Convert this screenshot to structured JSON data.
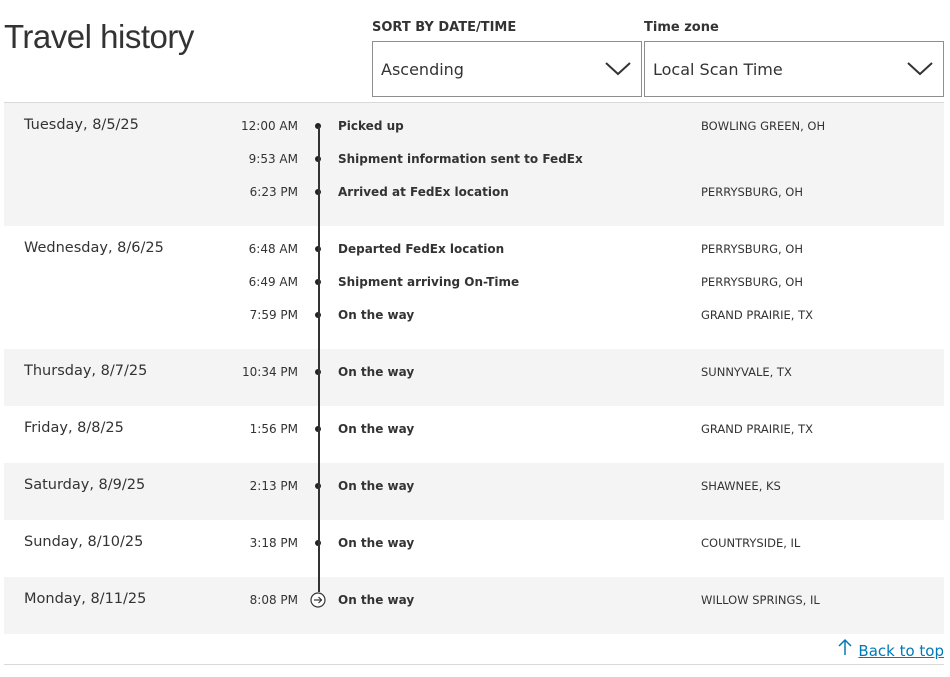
{
  "title": "Travel history",
  "sort": {
    "label": "SORT BY DATE/TIME",
    "value": "Ascending"
  },
  "timezone": {
    "label": "Time zone",
    "value": "Local Scan Time"
  },
  "groups": [
    {
      "day": "Tuesday, 8/5/25",
      "events": [
        {
          "time": "12:00 AM",
          "status": "Picked up",
          "location": "BOWLING GREEN, OH"
        },
        {
          "time": "9:53 AM",
          "status": "Shipment information sent to FedEx",
          "location": ""
        },
        {
          "time": "6:23 PM",
          "status": "Arrived at FedEx location",
          "location": "PERRYSBURG, OH"
        }
      ]
    },
    {
      "day": "Wednesday, 8/6/25",
      "events": [
        {
          "time": "6:48 AM",
          "status": "Departed FedEx location",
          "location": "PERRYSBURG, OH"
        },
        {
          "time": "6:49 AM",
          "status": "Shipment arriving On-Time",
          "location": "PERRYSBURG, OH"
        },
        {
          "time": "7:59 PM",
          "status": "On the way",
          "location": "GRAND PRAIRIE, TX"
        }
      ]
    },
    {
      "day": "Thursday, 8/7/25",
      "events": [
        {
          "time": "10:34 PM",
          "status": "On the way",
          "location": "SUNNYVALE, TX"
        }
      ]
    },
    {
      "day": "Friday, 8/8/25",
      "events": [
        {
          "time": "1:56 PM",
          "status": "On the way",
          "location": "GRAND PRAIRIE, TX"
        }
      ]
    },
    {
      "day": "Saturday, 8/9/25",
      "events": [
        {
          "time": "2:13 PM",
          "status": "On the way",
          "location": "SHAWNEE, KS"
        }
      ]
    },
    {
      "day": "Sunday, 8/10/25",
      "events": [
        {
          "time": "3:18 PM",
          "status": "On the way",
          "location": "COUNTRYSIDE, IL"
        }
      ]
    },
    {
      "day": "Monday, 8/11/25",
      "events": [
        {
          "time": "8:08 PM",
          "status": "On the way",
          "location": "WILLOW SPRINGS, IL",
          "current": true
        }
      ]
    }
  ],
  "back_to_top": "Back to top",
  "icons": {
    "dropdown": "chevron-down-icon",
    "timeline_marker": "dot-icon",
    "current_marker": "arrow-right-circle-icon",
    "back_to_top": "arrow-up-icon"
  },
  "colors": {
    "link": "#007ab7",
    "shade": "#f4f4f4",
    "text": "#333333"
  }
}
